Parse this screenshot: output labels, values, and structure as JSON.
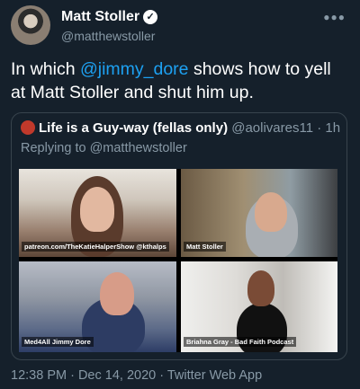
{
  "author": {
    "name": "Matt Stoller",
    "handle": "@matthewstoller",
    "verified_icon": "verified-badge-icon",
    "more_icon": "more-options-icon"
  },
  "tweet": {
    "text_before": "In which ",
    "mention": "@jimmy_dore",
    "text_after": " shows how to yell at Matt Stoller and shut him up."
  },
  "quoted_tweet": {
    "name": "Life is a Guy-way (fellas only)",
    "handle": "@aolivares11",
    "separator": " · ",
    "time": "1h",
    "replying_to": "Replying to @matthewstoller",
    "video_tiles": [
      {
        "caption": "patreon.com/TheKatieHalperShow @kthalps"
      },
      {
        "caption": "Matt Stoller"
      },
      {
        "caption": "Med4All Jimmy Dore"
      },
      {
        "caption": "Briahna Gray - Bad Faith Podcast"
      }
    ]
  },
  "footer": {
    "timestamp": "12:38 PM · Dec 14, 2020",
    "separator": " · ",
    "source": "Twitter Web App"
  },
  "colors": {
    "background": "#15202b",
    "accent": "#1da1f2",
    "secondary_text": "#8899a6"
  }
}
